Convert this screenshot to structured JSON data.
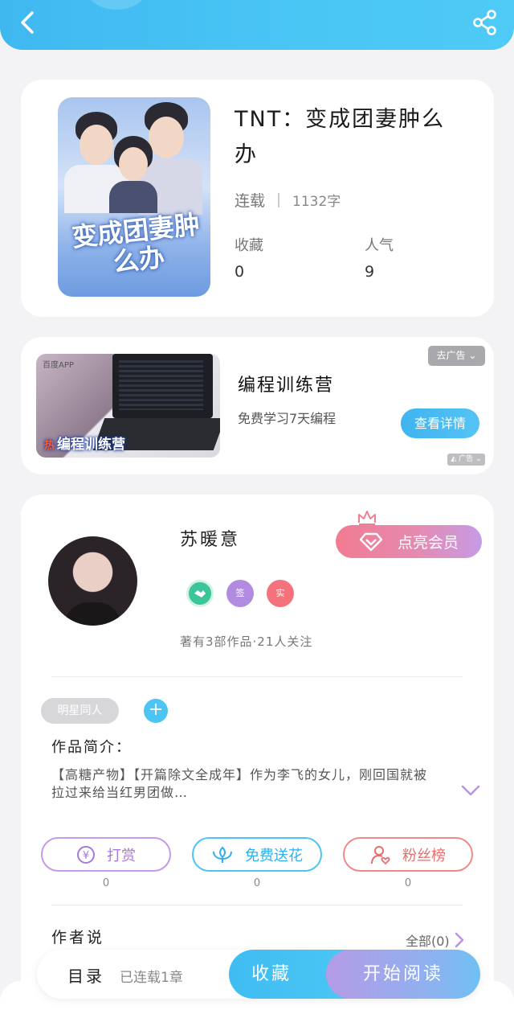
{
  "header": {
    "back_icon": "chevron-left-icon",
    "share_icon": "share-icon",
    "color": "#45bff3"
  },
  "book": {
    "title": "TNT：变成团妻肿么办",
    "cover_title": "变成团妻肿么办",
    "status": "连载",
    "word_count": "1132字",
    "favorites_label": "收藏",
    "favorites_value": "0",
    "popularity_label": "人气",
    "popularity_value": "9"
  },
  "ad": {
    "brand": "百度APP",
    "banner": "编程训练营",
    "hot": "热",
    "title": "编程训练营",
    "desc": "免费学习7天编程",
    "button": "查看详情",
    "close_label": "去广告",
    "tag": "广告"
  },
  "author": {
    "name": "苏暖意",
    "vip_button": "点亮会员",
    "badges": [
      "签",
      "实"
    ],
    "stats": "著有3部作品·21人关注",
    "tag": "明星同人",
    "intro_label": "作品简介：",
    "intro_text": "【高糖产物】【开篇除文全成年】作为李飞的女儿，刚回国就被拉过来给当红男团做…"
  },
  "actions": [
    {
      "label": "打赏",
      "count": "0",
      "icon": "yuan-coin-icon",
      "color": "#a67ad8"
    },
    {
      "label": "免费送花",
      "count": "0",
      "icon": "flower-icon",
      "color": "#2fb0ec"
    },
    {
      "label": "粉丝榜",
      "count": "0",
      "icon": "user-heart-icon",
      "color": "#e86c6c"
    }
  ],
  "author_says": {
    "label": "作者说",
    "all": "全部(0)"
  },
  "bottom_bar": {
    "toc": "目录",
    "chapters": "已连载1章",
    "collect": "收藏",
    "read": "开始阅读"
  }
}
